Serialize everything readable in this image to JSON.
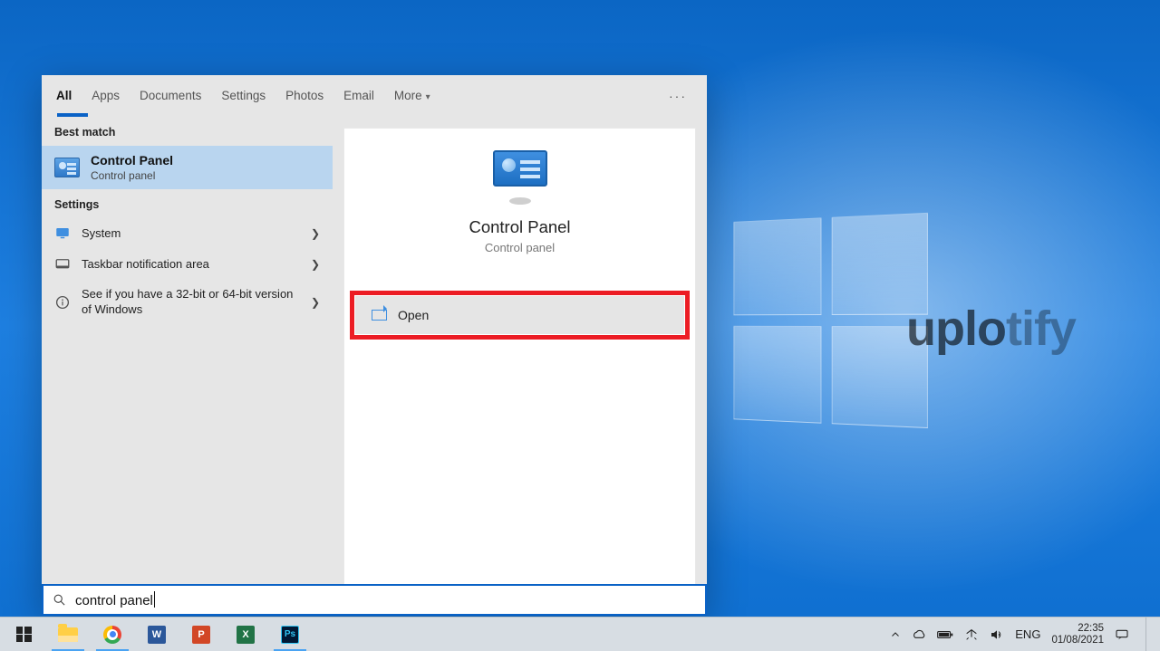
{
  "tabs": {
    "all": "All",
    "apps": "Apps",
    "documents": "Documents",
    "settings": "Settings",
    "photos": "Photos",
    "email": "Email",
    "more": "More"
  },
  "sections": {
    "best_match": "Best match",
    "settings": "Settings"
  },
  "best_match": {
    "title": "Control Panel",
    "subtitle": "Control panel"
  },
  "settings_rows": {
    "system": "System",
    "taskbar": "Taskbar notification area",
    "bitness": "See if you have a 32-bit or 64-bit version of Windows"
  },
  "details": {
    "title": "Control Panel",
    "subtitle": "Control panel",
    "action_open": "Open"
  },
  "search": {
    "query": "control panel"
  },
  "tray": {
    "lang": "ENG",
    "time": "22:35",
    "date": "01/08/2021"
  },
  "watermark": {
    "a": "uplo",
    "b": "tify"
  }
}
